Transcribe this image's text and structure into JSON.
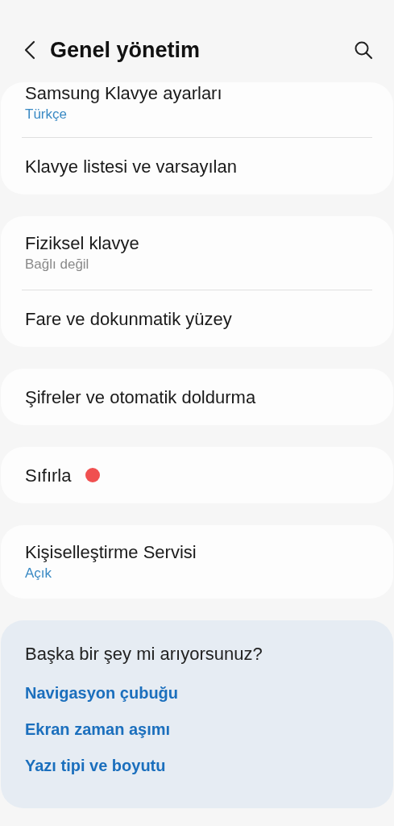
{
  "header": {
    "title": "Genel yönetim"
  },
  "groups": [
    {
      "items": [
        {
          "title": "Samsung Klavye ayarları",
          "subtitle": "Türkçe",
          "subtitle_active": true
        },
        {
          "title": "Klavye listesi ve varsayılan"
        }
      ]
    },
    {
      "items": [
        {
          "title": "Fiziksel klavye",
          "subtitle": "Bağlı değil",
          "subtitle_active": false
        },
        {
          "title": "Fare ve dokunmatik yüzey"
        }
      ]
    },
    {
      "items": [
        {
          "title": "Şifreler ve otomatik doldurma"
        }
      ]
    },
    {
      "items": [
        {
          "title": "Sıfırla",
          "color": "#f05050"
        }
      ]
    },
    {
      "items": [
        {
          "title": "Kişiselleştirme Servisi",
          "subtitle": "Açık",
          "subtitle_active": true
        }
      ]
    }
  ],
  "suggestions": {
    "heading": "Başka bir şey mi arıyorsunuz?",
    "links": [
      "Navigasyon çubuğu",
      "Ekran zaman aşımı",
      "Yazı tipi ve boyutu"
    ]
  }
}
